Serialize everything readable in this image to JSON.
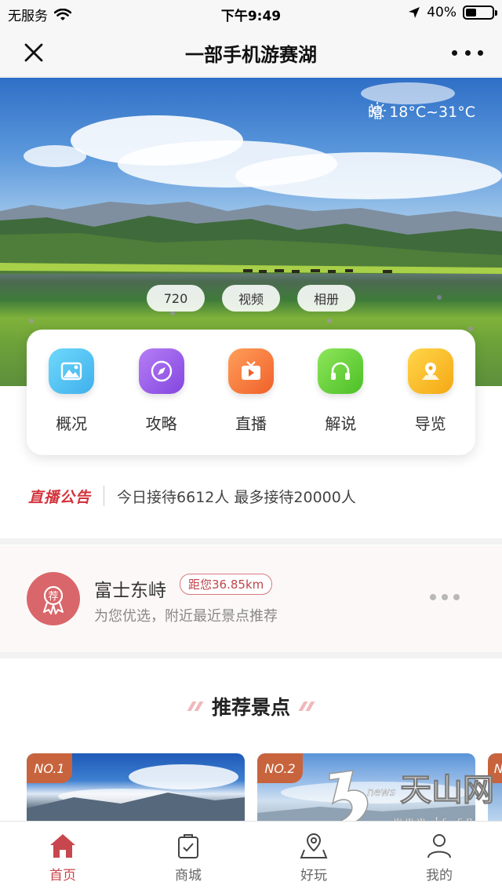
{
  "status_bar": {
    "carrier": "无服务",
    "time": "下午9:49",
    "battery": "40%",
    "battery_level": 0.4
  },
  "navbar": {
    "title": "一部手机游赛湖",
    "icons": {
      "close": "close-icon",
      "more": "more-icon"
    }
  },
  "hero": {
    "weather_condition": "晴",
    "weather_temp": "18°C~31°C",
    "pills": [
      "720",
      "视频",
      "相册"
    ]
  },
  "quick_menu": [
    {
      "label": "概况",
      "icon": "landscape-icon",
      "color": "#4cc6f2"
    },
    {
      "label": "攻略",
      "icon": "compass-icon",
      "color": "#9a5be8"
    },
    {
      "label": "直播",
      "icon": "tv-icon",
      "color": "#f77f3e"
    },
    {
      "label": "解说",
      "icon": "headphones-icon",
      "color": "#6fd23a"
    },
    {
      "label": "导览",
      "icon": "map-pin-icon",
      "color": "#f8c12a"
    }
  ],
  "notice": {
    "tag": "直播公告",
    "text": "今日接待6612人 最多接待20000人"
  },
  "recommend": {
    "badge": "荐",
    "name": "富士东峙",
    "distance": "距您36.85km",
    "description": "为您优选，附近最近景点推荐"
  },
  "section": {
    "title": "推荐景点"
  },
  "spots": [
    {
      "rank": "NO.1"
    },
    {
      "rank": "NO.2"
    },
    {
      "rank": "NO"
    }
  ],
  "watermark": {
    "brand": "天山网",
    "news": "news",
    "url": "w w w . t s . c n"
  },
  "tabbar": [
    {
      "label": "首页",
      "icon": "home-icon",
      "active": true
    },
    {
      "label": "商城",
      "icon": "shop-bag-icon",
      "active": false
    },
    {
      "label": "好玩",
      "icon": "map-location-icon",
      "active": false
    },
    {
      "label": "我的",
      "icon": "user-icon",
      "active": false
    }
  ],
  "colors": {
    "accent": "#c8464d",
    "notice_red": "#d4333d"
  }
}
